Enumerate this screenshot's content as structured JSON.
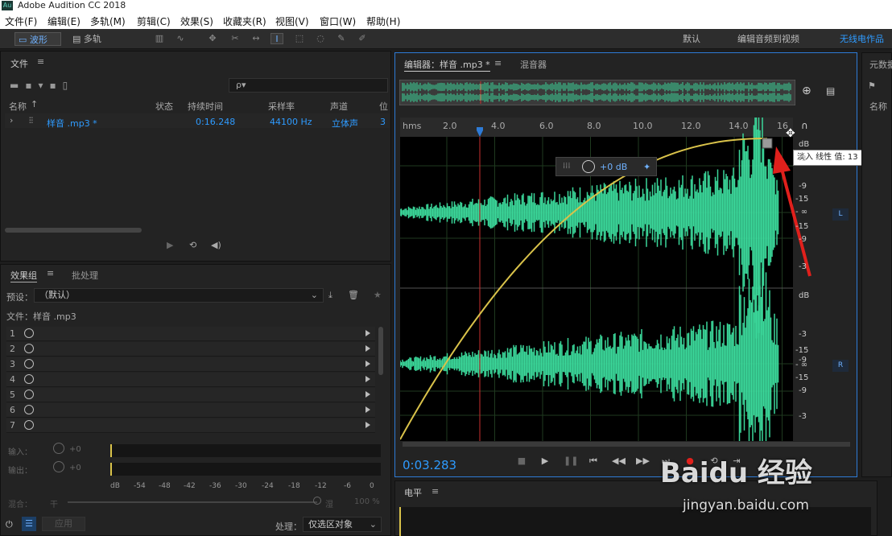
{
  "app": {
    "icon_text": "Au",
    "title": "Adobe Audition CC 2018"
  },
  "menu": [
    "文件(F)",
    "编辑(E)",
    "多轨(M)",
    "剪辑(C)",
    "效果(S)",
    "收藏夹(R)",
    "视图(V)",
    "窗口(W)",
    "帮助(H)"
  ],
  "toolbar": {
    "waveform": "波形",
    "multitrack": "多轨",
    "workspace_default": "默认",
    "workspace_edit_video": "编辑音频到视频",
    "workspace_user": "无线电作品"
  },
  "files_panel": {
    "title": "文件",
    "search_placeholder": "ρ▾",
    "columns": [
      "名称",
      "状态",
      "持续时间",
      "采样率",
      "声道",
      "位"
    ],
    "row": {
      "name": "样音 .mp3 *",
      "duration": "0:16.248",
      "sample_rate": "44100 Hz",
      "channels": "立体声",
      "bits": "3"
    }
  },
  "effects_panel": {
    "tab_effects": "效果组",
    "tab_batch": "批处理",
    "preset_label": "预设：",
    "preset_value": "（默认）",
    "file_label": "文件：样音 .mp3",
    "slots": [
      "1",
      "2",
      "3",
      "4",
      "5",
      "6",
      "7"
    ],
    "input_label": "输入：",
    "input_value": "+0",
    "output_label": "输出：",
    "output_value": "+0",
    "meter_ticks": [
      "dB",
      "-54",
      "-48",
      "-42",
      "-36",
      "-30",
      "-24",
      "-18",
      "-12",
      "-6",
      "0"
    ],
    "mix_label": "混合：",
    "mix_dry": "干",
    "mix_wet": "湿",
    "mix_pct": "100 %",
    "apply": "应用",
    "process_label": "处理：",
    "process_value": "仅选区对象"
  },
  "editor": {
    "tab_editor": "编辑器：样音 .mp3 *",
    "tab_mixer": "混音器",
    "ruler": [
      "hms",
      "2.0",
      "4.0",
      "6.0",
      "8.0",
      "10.0",
      "12.0",
      "14.0",
      "16"
    ],
    "hud_value": "+0 dB",
    "tooltip": "淡入 线性 值: 13",
    "db_left": [
      "dB",
      "-3",
      "-9",
      "-15",
      "- ∞",
      "-15",
      "-9",
      "-3"
    ],
    "db_right": [
      "dB",
      "-3",
      "-9",
      "-15",
      "- ∞",
      "-15",
      "-9",
      "-3"
    ],
    "channel_l": "L",
    "channel_r": "R",
    "time": "0:03.283"
  },
  "levels_panel": {
    "title": "电平"
  },
  "metadata_panel": {
    "title": "元数据",
    "col_name": "名称"
  },
  "watermark": {
    "brand": "Baidu 经验",
    "url": "jingyan.baidu.com"
  },
  "colors": {
    "accent": "#2e9bff",
    "waveform": "#3bd79a",
    "fade_curve": "#d9c24a",
    "playhead": "#c8302f",
    "arrow": "#e0201c"
  }
}
